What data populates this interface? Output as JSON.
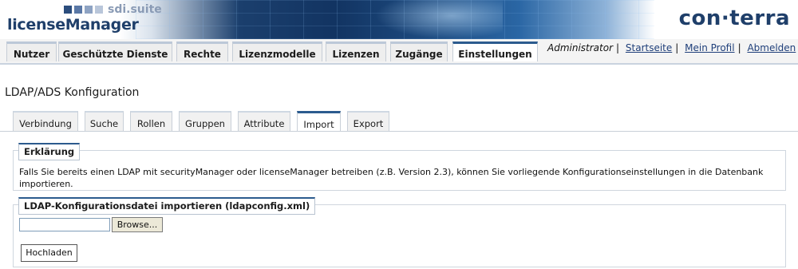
{
  "header": {
    "suite": "sdi.suite",
    "product": "licenseManager",
    "brand": "con·terra"
  },
  "mainnav": {
    "tabs": [
      {
        "label": "Nutzer"
      },
      {
        "label": "Geschützte Dienste"
      },
      {
        "label": "Rechte"
      },
      {
        "label": "Lizenzmodelle"
      },
      {
        "label": "Lizenzen"
      },
      {
        "label": "Zugänge"
      },
      {
        "label": "Einstellungen",
        "active": true
      }
    ],
    "role": "Administrator",
    "links": [
      "Startseite",
      "Mein Profil",
      "Abmelden"
    ]
  },
  "page": {
    "title": "LDAP/ADS Konfiguration"
  },
  "subnav": {
    "tabs": [
      {
        "label": "Verbindung"
      },
      {
        "label": "Suche"
      },
      {
        "label": "Rollen"
      },
      {
        "label": "Gruppen"
      },
      {
        "label": "Attribute"
      },
      {
        "label": "Import",
        "active": true
      },
      {
        "label": "Export"
      }
    ]
  },
  "explanation": {
    "legend": "Erklärung",
    "text": "Falls Sie bereits einen LDAP mit securityManager oder licenseManager betreiben (z.B. Version 2.3), können Sie vorliegende Konfigurationseinstellungen in die Datenbank importieren."
  },
  "import": {
    "legend": "LDAP-Konfigurationsdatei importieren (ldapconfig.xml)",
    "file_value": "",
    "browse_label": "Browse...",
    "upload_label": "Hochladen"
  },
  "colors": {
    "accent": "#2c5b8e",
    "brand": "#1f3f6a"
  },
  "icons": [
    "sdi-suite-logo-squares"
  ]
}
